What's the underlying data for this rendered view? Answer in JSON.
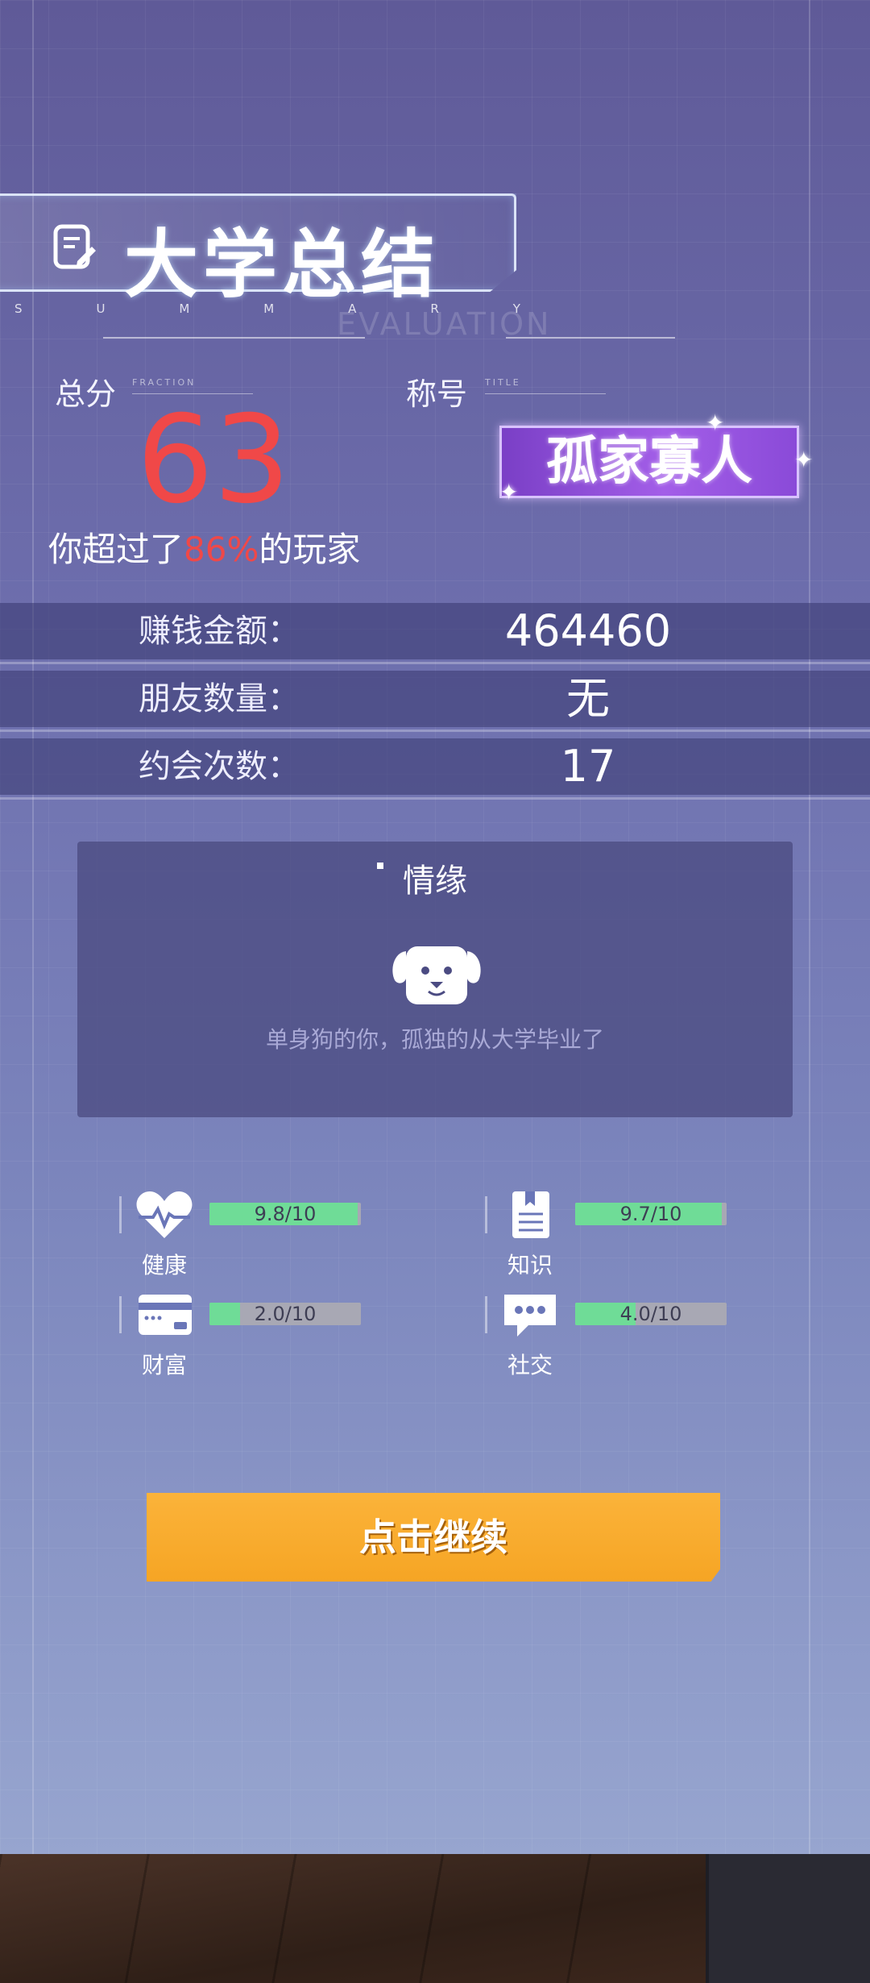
{
  "header": {
    "title": "大学总结",
    "subtitle_letters": [
      "S",
      "U",
      "M",
      "M",
      "A",
      "R",
      "Y"
    ],
    "watermark": "EVALUATION"
  },
  "score": {
    "label": "总分",
    "sublabel": "FRACTION",
    "value": "63",
    "exceed_prefix": "你超过了",
    "exceed_percent": "86%",
    "exceed_suffix": "的玩家"
  },
  "title_badge": {
    "label": "称号",
    "sublabel": "TITLE",
    "value": "孤家寡人"
  },
  "stats": [
    {
      "label": "赚钱金额：",
      "value": "464460"
    },
    {
      "label": "朋友数量：",
      "value": "无"
    },
    {
      "label": "约会次数：",
      "value": "17"
    }
  ],
  "romance": {
    "title": "情缘",
    "icon": "dog-face-icon",
    "text": "单身狗的你，孤独的从大学毕业了"
  },
  "attributes": [
    {
      "name": "健康",
      "icon": "heart-pulse-icon",
      "score_text": "9.8/10",
      "fraction": 0.98
    },
    {
      "name": "知识",
      "icon": "book-icon",
      "score_text": "9.7/10",
      "fraction": 0.97
    },
    {
      "name": "财富",
      "icon": "credit-card-icon",
      "score_text": "2.0/10",
      "fraction": 0.2
    },
    {
      "name": "社交",
      "icon": "chat-bubble-icon",
      "score_text": "4.0/10",
      "fraction": 0.4
    }
  ],
  "continue_button": {
    "label": "点击继续"
  },
  "colors": {
    "accent_red": "#f04848",
    "bar_green": "#6fdc97",
    "button_orange": "#f6a524",
    "badge_purple": "#a35ee8"
  }
}
